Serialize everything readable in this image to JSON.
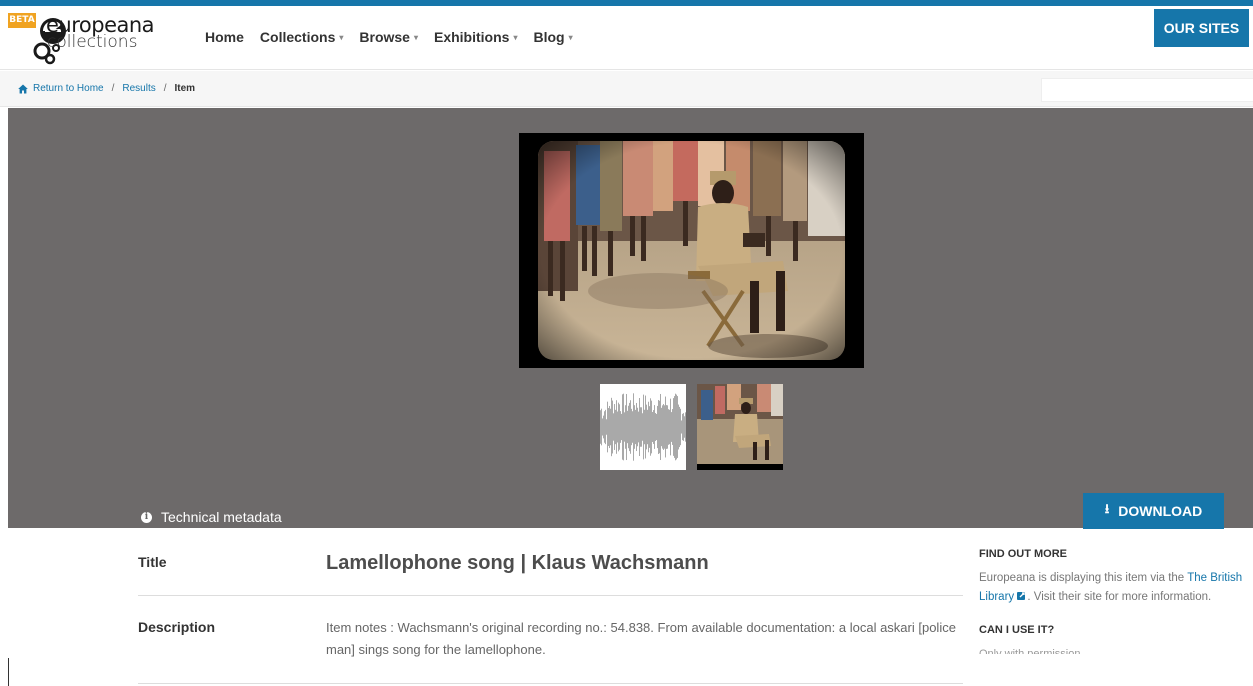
{
  "colors": {
    "accent_blue": "#1676aa",
    "beta_orange": "#f0a321",
    "media_background": "#6d6a6a",
    "link_blue": "#1676aa",
    "top_line_blue": "#1676aa"
  },
  "header": {
    "beta_label": "BETA",
    "logo_line1": "europeana",
    "logo_line2": "collections",
    "nav": [
      {
        "label": "Home",
        "has_caret": false
      },
      {
        "label": "Collections",
        "has_caret": true
      },
      {
        "label": "Browse",
        "has_caret": true
      },
      {
        "label": "Exhibitions",
        "has_caret": true
      },
      {
        "label": "Blog",
        "has_caret": true
      }
    ],
    "our_sites_label": "OUR SITES"
  },
  "breadcrumb": {
    "home_icon": "home-icon",
    "home_label": "Return to Home",
    "results_label": "Results",
    "current_label": "Item",
    "separator": "/"
  },
  "media": {
    "main_image_alt": "Color photograph: seated man in khaki uniform playing a lamellophone surrounded by standing children",
    "thumbnails": [
      {
        "type": "audio-waveform"
      },
      {
        "type": "photo"
      }
    ],
    "technical_metadata_label": "Technical metadata",
    "download_label": "DOWNLOAD"
  },
  "metadata": {
    "title_label": "Title",
    "title_value": "Lamellophone song | Klaus Wachsmann",
    "description_label": "Description",
    "description_value": "Item notes : Wachsmann's original recording no.: 54.838.  From available documentation: a local askari [police man] sings song for the lamellophone."
  },
  "side": {
    "find_out_more_heading": "FIND OUT MORE",
    "find_text_before": "Europeana is displaying this item via the ",
    "provider_link": "The British Library",
    "find_text_after": ". Visit their site for more information.",
    "can_i_use_heading": "CAN I USE IT?",
    "can_i_use_text": "Only with permission"
  }
}
